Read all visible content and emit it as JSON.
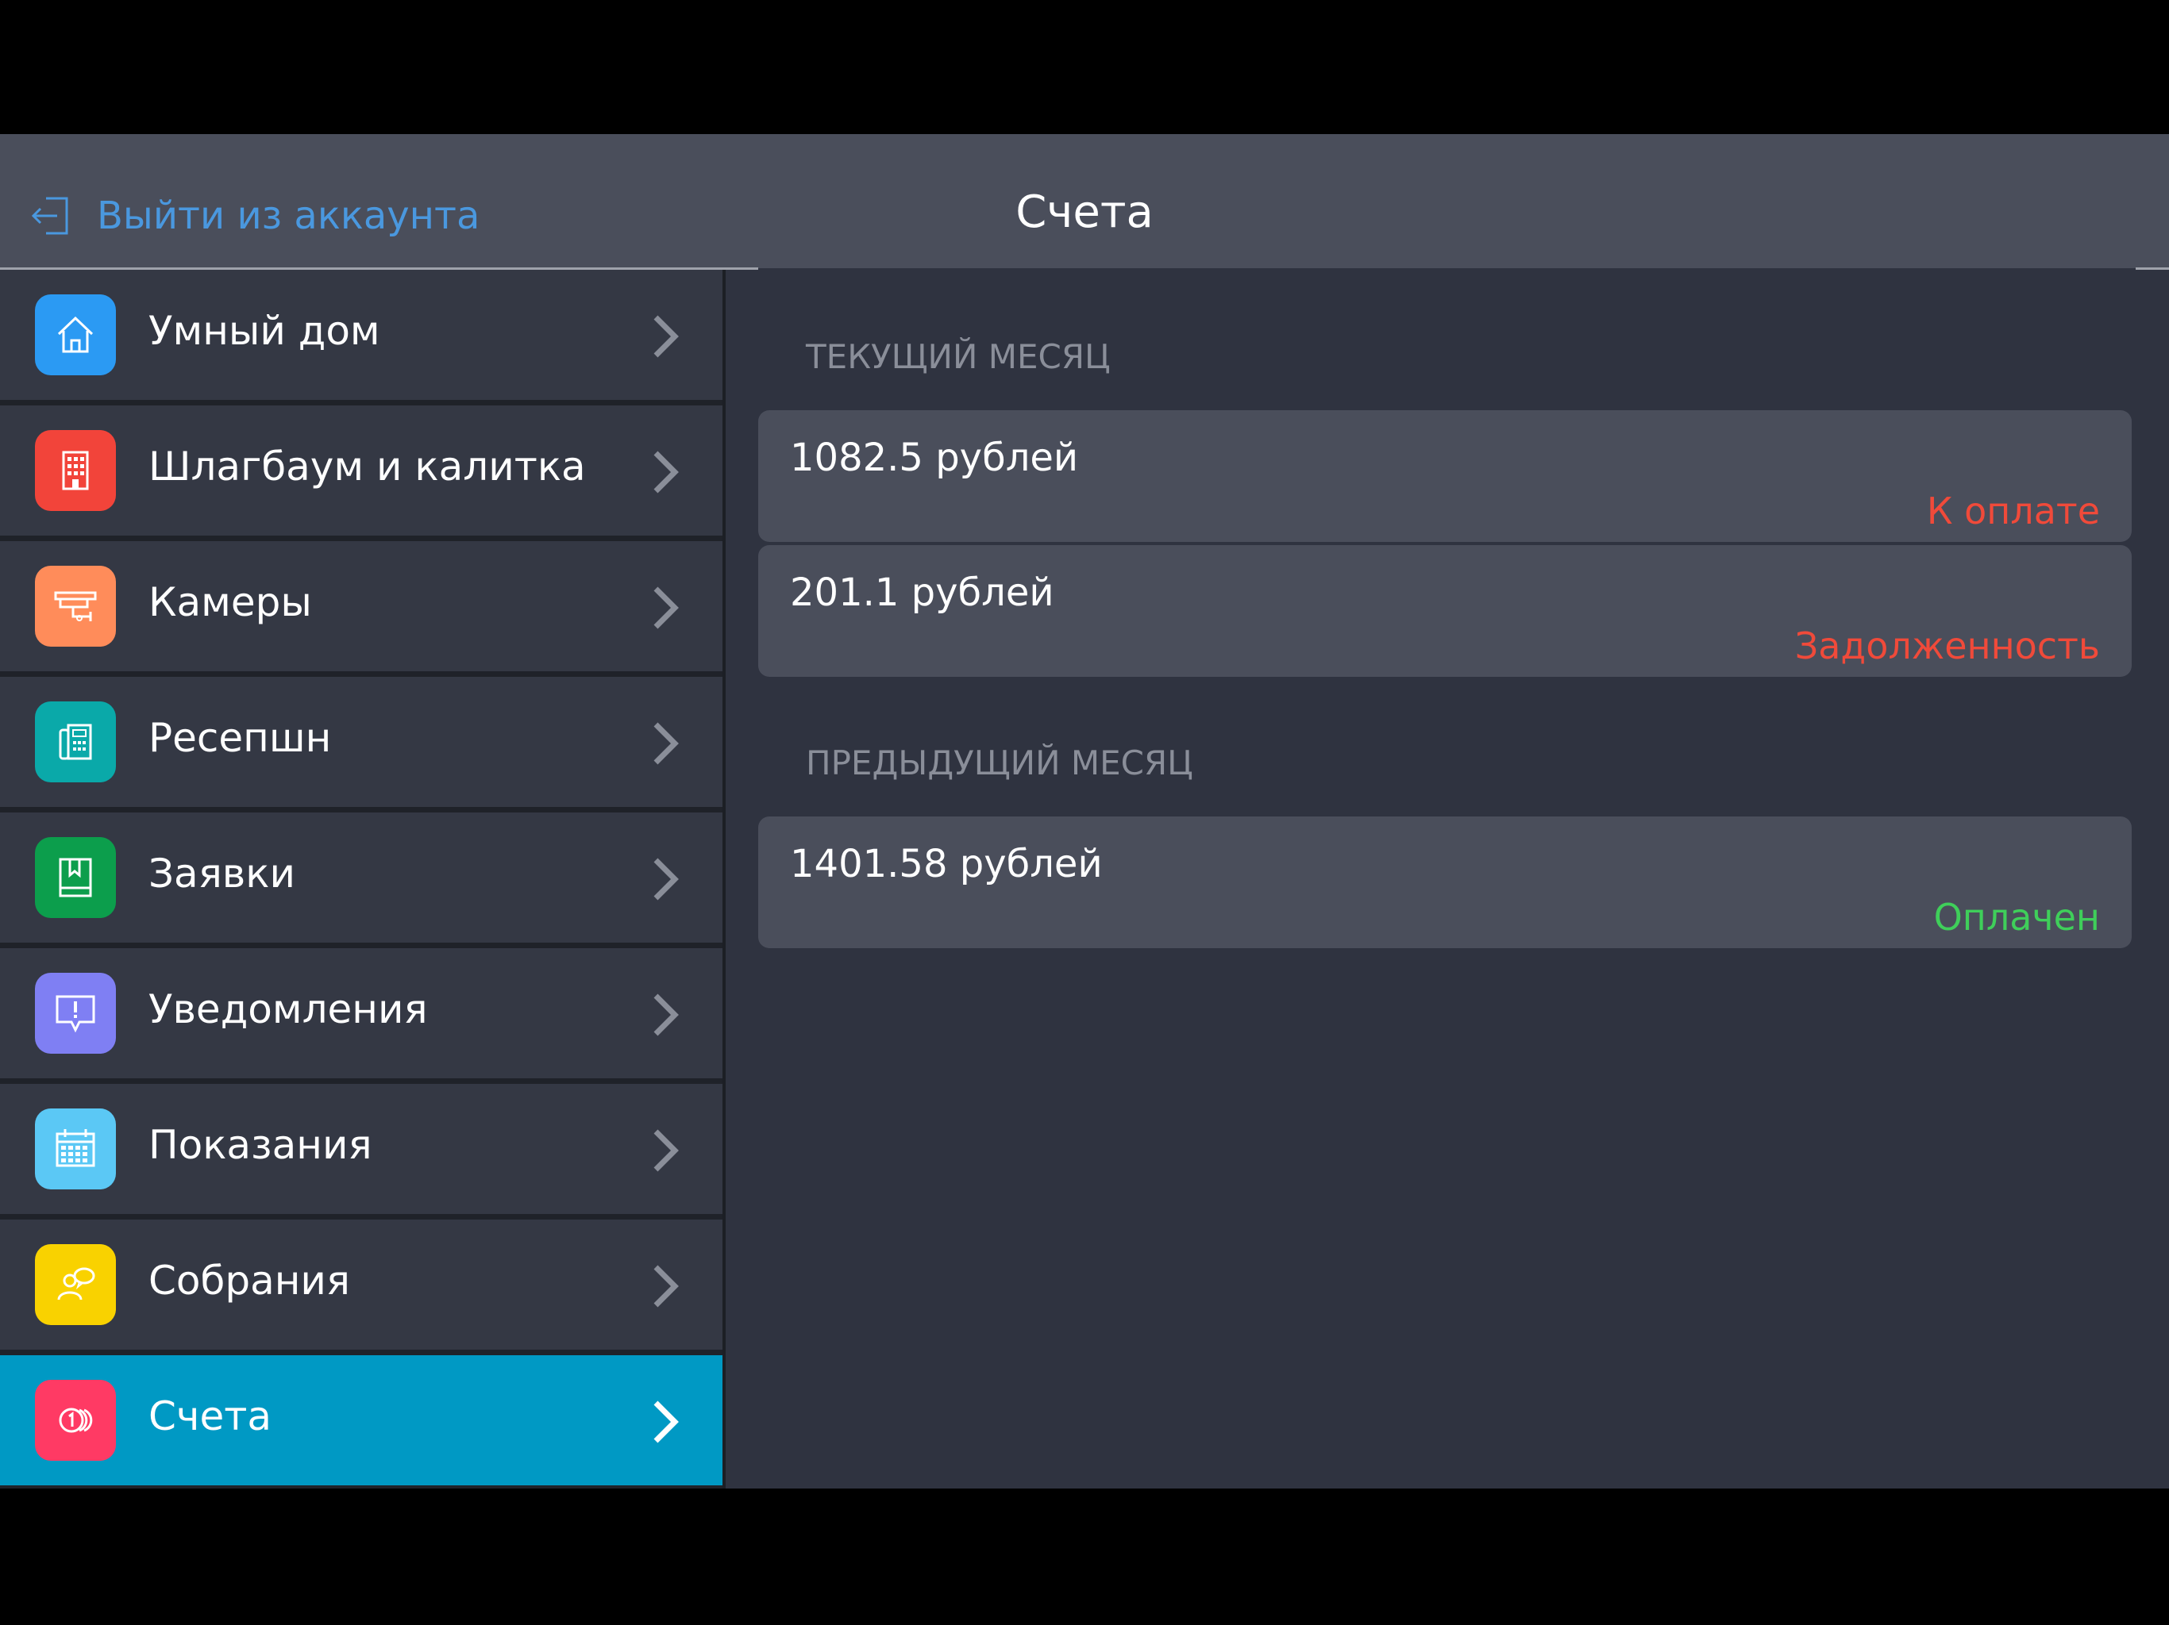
{
  "header": {
    "logout_label": "Выйти из аккаунта",
    "title": "Счета"
  },
  "colors": {
    "header_bg": "#4a4e5b",
    "main_bg": "#2f3340",
    "accent_link": "#4a98df",
    "active_item": "#0099c4",
    "status_due": "#f04a3a",
    "status_paid": "#3fcf5a"
  },
  "sidebar": {
    "items": [
      {
        "label": "Умный дом",
        "icon": "home-icon",
        "icon_color": "#2b9af3",
        "active": false
      },
      {
        "label": "Шлагбаум и калитка",
        "icon": "building-icon",
        "icon_color": "#f2443a",
        "active": false
      },
      {
        "label": "Камеры",
        "icon": "camera-icon",
        "icon_color": "#ff8c5a",
        "active": false
      },
      {
        "label": "Ресепшн",
        "icon": "reception-phone-icon",
        "icon_color": "#0aa9a9",
        "active": false
      },
      {
        "label": "Заявки",
        "icon": "bookmark-book-icon",
        "icon_color": "#0c9e4c",
        "active": false
      },
      {
        "label": "Уведомления",
        "icon": "alert-bubble-icon",
        "icon_color": "#7f7ff3",
        "active": false
      },
      {
        "label": "Показания",
        "icon": "calendar-grid-icon",
        "icon_color": "#5bc8f5",
        "active": false
      },
      {
        "label": "Собрания",
        "icon": "people-chat-icon",
        "icon_color": "#f9d200",
        "active": false
      },
      {
        "label": "Счета",
        "icon": "coins-icon",
        "icon_color": "#ff3a64",
        "active": true
      }
    ]
  },
  "main": {
    "current_month": {
      "label": "ТЕКУЩИЙ МЕСЯЦ",
      "bills": [
        {
          "amount": "1082.5 рублей",
          "status": "К оплате",
          "status_color": "#f04a3a"
        },
        {
          "amount": "201.1 рублей",
          "status": "Задолженность",
          "status_color": "#f04a3a"
        }
      ]
    },
    "previous_month": {
      "label": "ПРЕДЫДУЩИЙ МЕСЯЦ",
      "bills": [
        {
          "amount": "1401.58 рублей",
          "status": "Оплачен",
          "status_color": "#3fcf5a"
        }
      ]
    }
  }
}
